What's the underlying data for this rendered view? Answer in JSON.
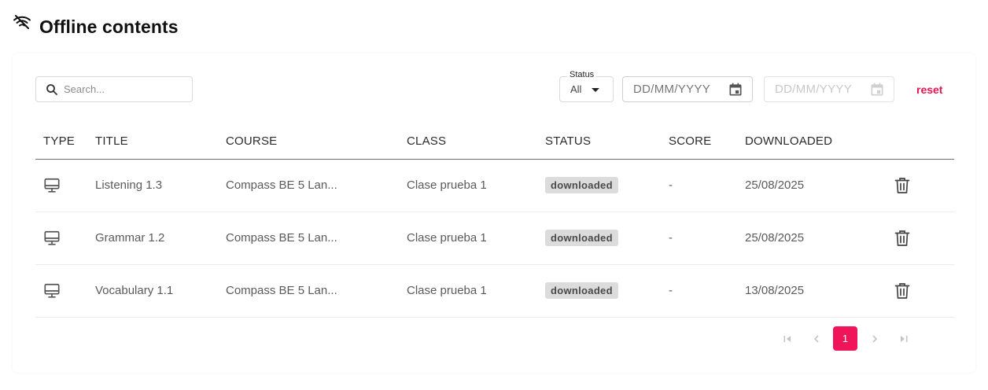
{
  "page": {
    "title": "Offline contents",
    "title_icon": "wifi-off-icon"
  },
  "filters": {
    "search_placeholder": "Search...",
    "status_label": "Status",
    "status_value": "All",
    "date_from_placeholder": "DD/MM/YYYY",
    "date_to_placeholder": "DD/MM/YYYY",
    "reset_label": "reset"
  },
  "table": {
    "headers": [
      "TYPE",
      "TITLE",
      "COURSE",
      "CLASS",
      "STATUS",
      "SCORE",
      "DOWNLOADED"
    ],
    "rows": [
      {
        "type_icon": "desktop-icon",
        "title": "Listening 1.3",
        "course": "Compass BE 5 Lan...",
        "class": "Clase prueba 1",
        "status": "downloaded",
        "score": "-",
        "downloaded": "25/08/2025"
      },
      {
        "type_icon": "desktop-icon",
        "title": "Grammar 1.2",
        "course": "Compass BE 5 Lan...",
        "class": "Clase prueba 1",
        "status": "downloaded",
        "score": "-",
        "downloaded": "25/08/2025"
      },
      {
        "type_icon": "desktop-icon",
        "title": "Vocabulary 1.1",
        "course": "Compass BE 5 Lan...",
        "class": "Clase prueba 1",
        "status": "downloaded",
        "score": "-",
        "downloaded": "13/08/2025"
      }
    ]
  },
  "pagination": {
    "current_page": "1"
  },
  "colors": {
    "accent": "#f0155a",
    "reset": "#e8164f",
    "badge_bg": "#dcdcdc"
  }
}
